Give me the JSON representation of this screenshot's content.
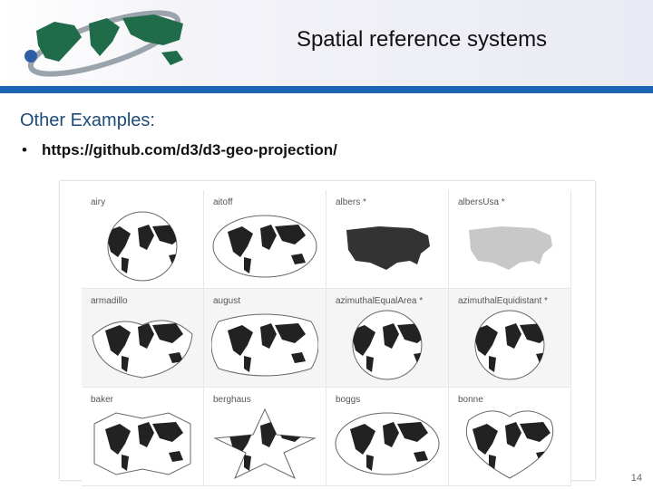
{
  "slide": {
    "title": "Spatial reference systems",
    "subtitle": "Other Examples:",
    "bullet": "https://github.com/d3/d3-geo-projection/",
    "page_number": "14"
  },
  "gallery": {
    "projections": [
      {
        "label": "airy",
        "shape": "circle",
        "fill": "#222"
      },
      {
        "label": "aitoff",
        "shape": "ellipse",
        "fill": "#222"
      },
      {
        "label": "albers *",
        "shape": "usa",
        "fill": "#333"
      },
      {
        "label": "albersUsa *",
        "shape": "usa",
        "fill": "#c8c8c8"
      },
      {
        "label": "armadillo",
        "shape": "armadillo",
        "fill": "#222"
      },
      {
        "label": "august",
        "shape": "august",
        "fill": "#222"
      },
      {
        "label": "azimuthalEqualArea *",
        "shape": "circle",
        "fill": "#222"
      },
      {
        "label": "azimuthalEquidistant *",
        "shape": "circle",
        "fill": "#222"
      },
      {
        "label": "baker",
        "shape": "baker",
        "fill": "#222"
      },
      {
        "label": "berghaus",
        "shape": "star",
        "fill": "#222"
      },
      {
        "label": "boggs",
        "shape": "ellipse",
        "fill": "#222"
      },
      {
        "label": "bonne",
        "shape": "heart",
        "fill": "#222"
      }
    ]
  },
  "colors": {
    "header_rule": "#1e64b4",
    "logo_land": "#1f6b4a",
    "logo_ring": "#9aa4ad",
    "subtitle": "#1d4c7a"
  }
}
